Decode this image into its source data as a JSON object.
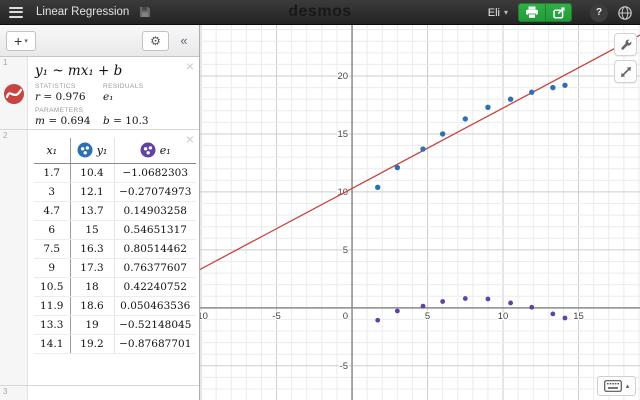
{
  "header": {
    "title": "Linear Regression",
    "brand": "desmos",
    "user": "Eli",
    "caret": "▾",
    "help": "?"
  },
  "toolbar": {
    "add": "+",
    "add_caret": "▾",
    "gear": "⚙",
    "collapse": "«"
  },
  "expr1": {
    "num": "1",
    "formula": "y₁ ~ mx₁ + b",
    "close": "×",
    "stats_label": "STATISTICS",
    "r_var": "r",
    "r_val": "= 0.976",
    "residuals_label": "RESIDUALS",
    "residual_sym": "e₁",
    "params_label": "PARAMETERS",
    "m_var": "m",
    "m_val": "= 0.694",
    "b_var": "b",
    "b_val": "= 10.3"
  },
  "expr2": {
    "num": "2",
    "close": "×"
  },
  "expr3": {
    "num": "3"
  },
  "table": {
    "columns": [
      "x₁",
      "y₁",
      "e₁"
    ],
    "rows": [
      [
        "1.7",
        "10.4",
        "−1.0682303"
      ],
      [
        "3",
        "12.1",
        "−0.27074973"
      ],
      [
        "4.7",
        "13.7",
        "0.14903258"
      ],
      [
        "6",
        "15",
        "0.54651317"
      ],
      [
        "7.5",
        "16.3",
        "0.80514462"
      ],
      [
        "9",
        "17.3",
        "0.76377607"
      ],
      [
        "10.5",
        "18",
        "0.42240752"
      ],
      [
        "11.9",
        "18.6",
        "0.050463536"
      ],
      [
        "13.3",
        "19",
        "−0.52148045"
      ],
      [
        "14.1",
        "19.2",
        "−0.87687701"
      ]
    ]
  },
  "keyboard": {
    "caret": "▴"
  },
  "colors": {
    "blue": "#2d70b3",
    "purple": "#6042a6",
    "red": "#c74440",
    "green": "#29a23e"
  },
  "chart_data": {
    "type": "scatter",
    "x": [
      1.7,
      3,
      4.7,
      6,
      7.5,
      9,
      10.5,
      11.9,
      13.3,
      14.1
    ],
    "series": [
      {
        "name": "y1",
        "color": "#2d70b3",
        "values": [
          10.4,
          12.1,
          13.7,
          15,
          16.3,
          17.3,
          18,
          18.6,
          19,
          19.2
        ]
      },
      {
        "name": "e1 residuals",
        "color": "#6042a6",
        "values": [
          -1.0682303,
          -0.27074973,
          0.14903258,
          0.54651317,
          0.80514462,
          0.76377607,
          0.42240752,
          0.050463536,
          -0.52148045,
          -0.87687701
        ]
      }
    ],
    "regression_line": {
      "m": 0.694,
      "b": 10.3,
      "color": "#c74440"
    },
    "xlim": [
      -10.07,
      19.07
    ],
    "ylim": [
      -7.95,
      24.4
    ],
    "grid": {
      "minor_step": 1,
      "major_step": 5,
      "minor_color": "#ececec",
      "major_color": "#cdcdcd",
      "axis_color": "#8a8a8a",
      "label_color": "#444444"
    }
  }
}
